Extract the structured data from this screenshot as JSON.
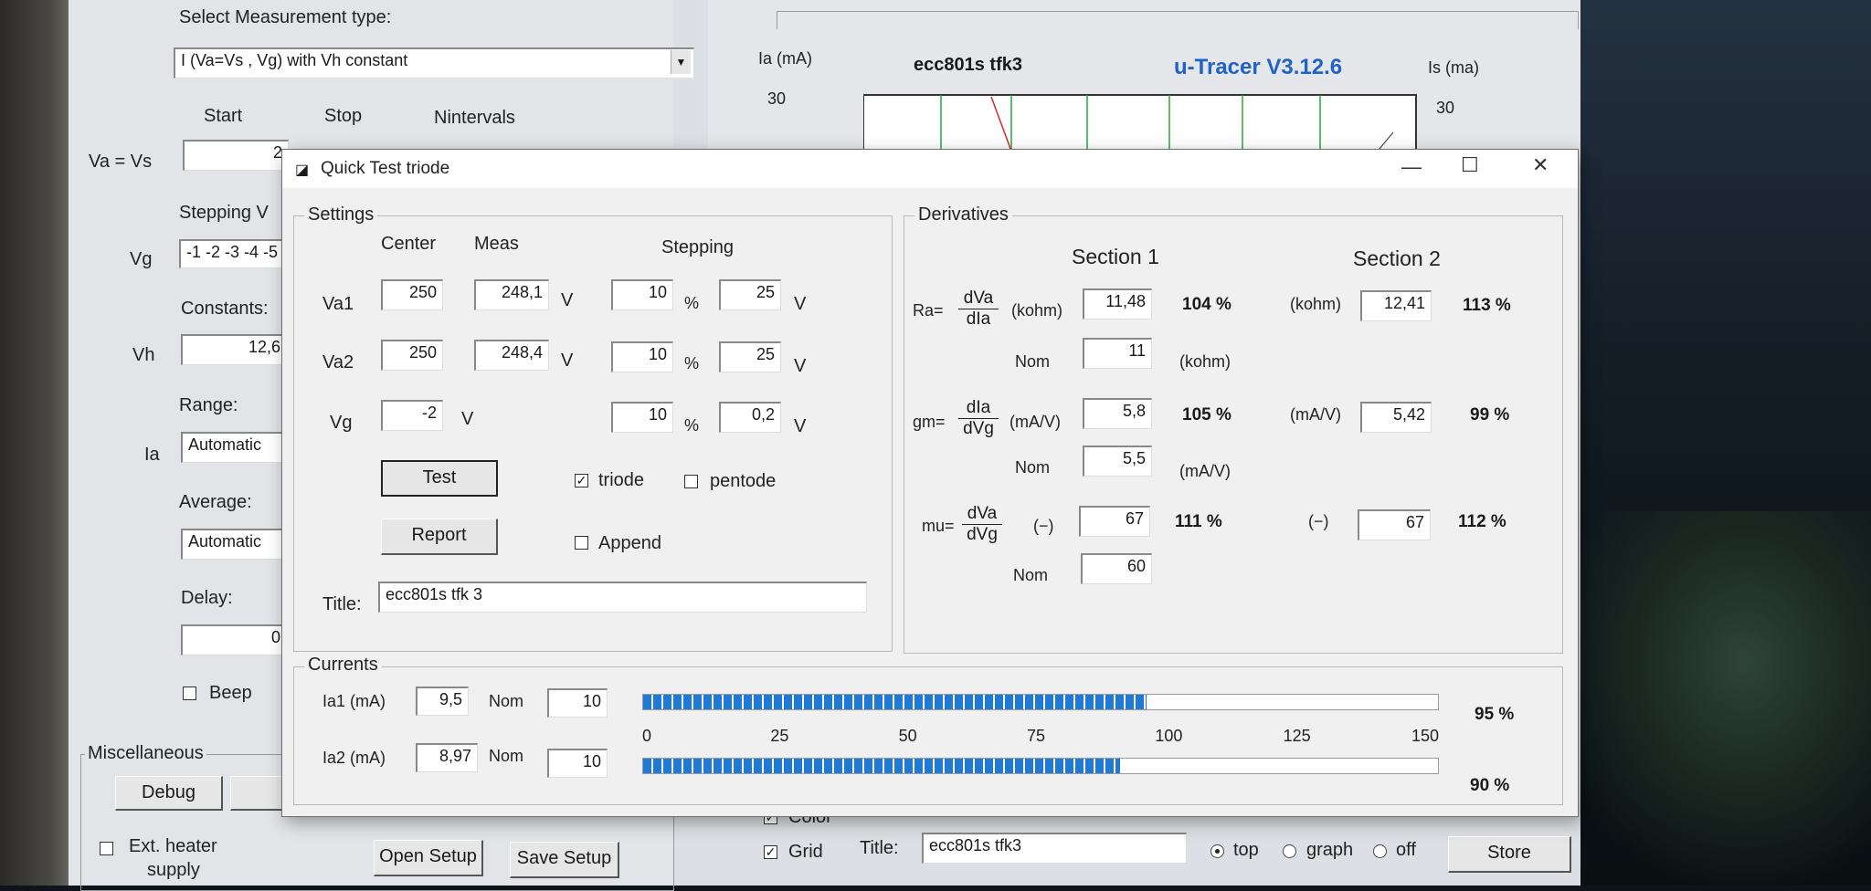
{
  "main": {
    "measurement_label": "Select Measurement type:",
    "measurement_value": "I (Va=Vs , Vg) with Vh constant",
    "col_start": "Start",
    "col_stop": "Stop",
    "col_nintervals": "Nintervals",
    "va_label": "Va = Vs",
    "va_start": "2",
    "stepping_label": "Stepping V",
    "vg_label": "Vg",
    "vg_value": "-1 -2 -3 -4 -5",
    "constants_label": "Constants:",
    "vh_label": "Vh",
    "vh_value": "12,6",
    "range_label": "Range:",
    "ia_label": "Ia",
    "range_value": "Automatic",
    "average_label": "Average:",
    "average_value": "Automatic",
    "delay_label": "Delay:",
    "delay_value": "0",
    "beep_label": "Beep",
    "misc_label": "Miscellaneous",
    "debug_label": "Debug",
    "ext_heater_label": "Ext. heater",
    "ext_heater_label2": "supply",
    "open_setup_label": "Open Setup",
    "save_setup_label": "Save Setup"
  },
  "graph": {
    "ia_axis": "Ia (mA)",
    "title": "ecc801s tfk3",
    "brand": "u-Tracer V3.12.6",
    "is_axis": "Is (ma)",
    "y_left_max": "30",
    "y_right_max": "30",
    "color_label": "Color",
    "grid_label": "Grid",
    "title_label": "Title:",
    "title_value": "ecc801s tfk3",
    "top_label": "top",
    "graph_label": "graph",
    "off_label": "off",
    "store_label": "Store"
  },
  "dialog": {
    "title": "Quick Test triode",
    "settings": {
      "group_title": "Settings",
      "center_header": "Center",
      "meas_header": "Meas",
      "stepping_header": "Stepping",
      "va1_label": "Va1",
      "va1_center": "250",
      "va1_meas": "248,1",
      "va1_step_pct": "10",
      "va1_step_v": "25",
      "va2_label": "Va2",
      "va2_center": "250",
      "va2_meas": "248,4",
      "va2_step_pct": "10",
      "va2_step_v": "25",
      "vg_label": "Vg",
      "vg_center": "-2",
      "vg_step_pct": "10",
      "vg_step_v": "0,2",
      "unit_v": "V",
      "unit_pct": "%",
      "test_label": "Test",
      "report_label": "Report",
      "triode_label": "triode",
      "pentode_label": "pentode",
      "append_label": "Append",
      "title_label": "Title:",
      "title_value": "ecc801s tfk 3"
    },
    "derivatives": {
      "group_title": "Derivatives",
      "section1": "Section 1",
      "section2": "Section 2",
      "ra_prefix": "Ra=",
      "ra_num": "dVa",
      "ra_den": "dIa",
      "ra_unit": "(kohm)",
      "ra_s1": "11,48",
      "ra_s1_pct": "104 %",
      "ra_s2": "12,41",
      "ra_s2_pct": "113 %",
      "ra_nom_label": "Nom",
      "ra_nom": "11",
      "gm_prefix": "gm=",
      "gm_num": "dIa",
      "gm_den": "dVg",
      "gm_unit": "(mA/V)",
      "gm_s1": "5,8",
      "gm_s1_pct": "105 %",
      "gm_s2": "5,42",
      "gm_s2_pct": "99 %",
      "gm_nom_label": "Nom",
      "gm_nom": "5,5",
      "mu_prefix": "mu=",
      "mu_num": "dVa",
      "mu_den": "dVg",
      "mu_unit": "(−)",
      "mu_s1": "67",
      "mu_s1_pct": "111 %",
      "mu_s2": "67",
      "mu_s2_pct": "112 %",
      "mu_nom_label": "Nom",
      "mu_nom": "60"
    },
    "currents": {
      "group_title": "Currents",
      "ia1_label": "Ia1 (mA)",
      "ia1_value": "9,5",
      "ia1_nom_label": "Nom",
      "ia1_nom": "10",
      "ia1_pct": "95 %",
      "ia1_fraction": 0.6333,
      "ia2_label": "Ia2 (mA)",
      "ia2_value": "8,97",
      "ia2_nom_label": "Nom",
      "ia2_nom": "10",
      "ia2_pct": "90 %",
      "ia2_fraction": 0.6,
      "scale": [
        "0",
        "25",
        "50",
        "75",
        "100",
        "125",
        "150"
      ]
    }
  }
}
